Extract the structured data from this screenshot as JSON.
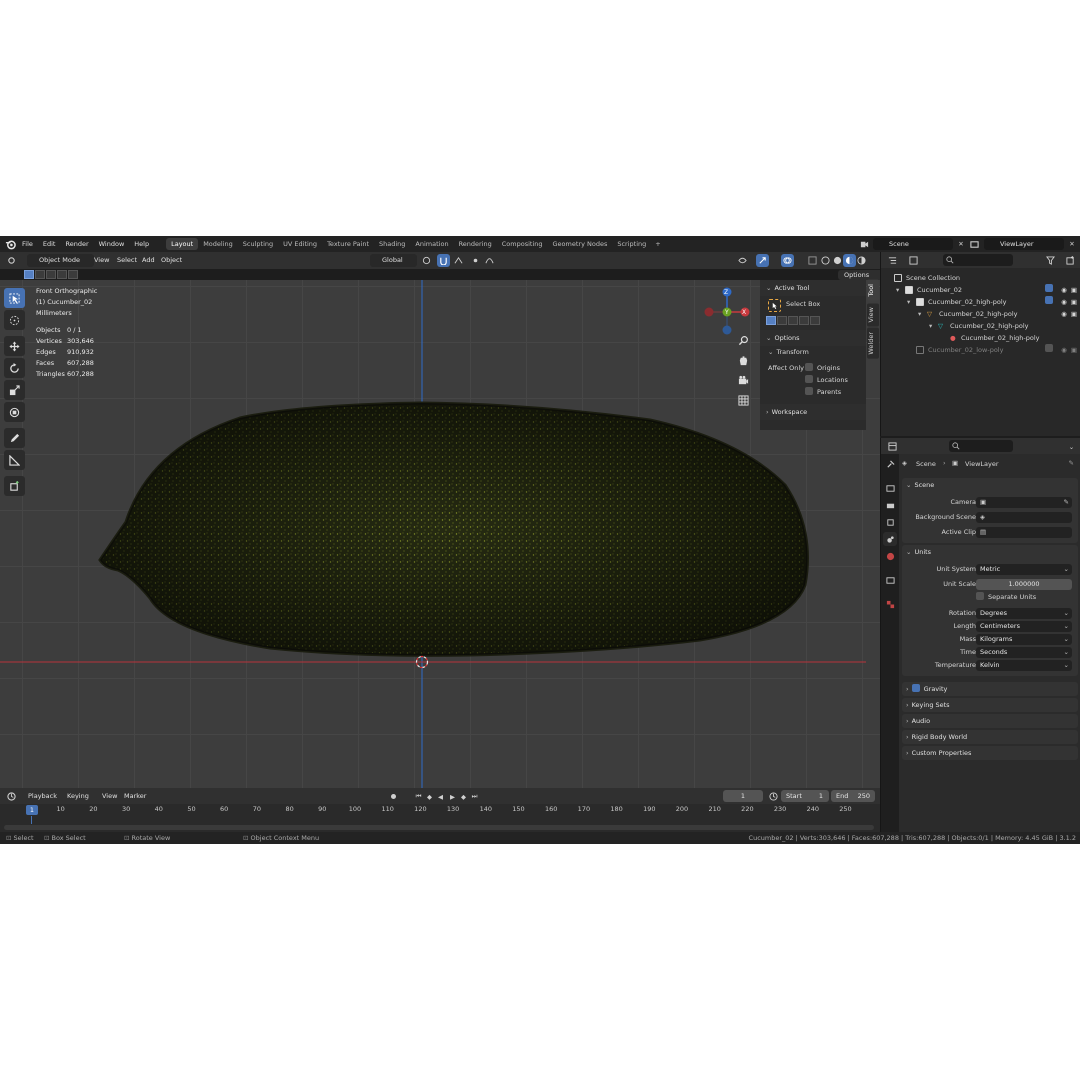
{
  "topbar": {
    "menus": [
      "File",
      "Edit",
      "Render",
      "Window",
      "Help"
    ],
    "workspaces": [
      "Layout",
      "Modeling",
      "Sculpting",
      "UV Editing",
      "Texture Paint",
      "Shading",
      "Animation",
      "Rendering",
      "Compositing",
      "Geometry Nodes",
      "Scripting"
    ],
    "active_workspace": "Layout",
    "plus": "+",
    "scene": "Scene",
    "view_layer": "ViewLayer"
  },
  "viewport_header": {
    "mode": "Object Mode",
    "menus": [
      "View",
      "Select",
      "Add",
      "Object"
    ],
    "orientation": "Global",
    "options": "Options"
  },
  "overlay": {
    "view": "Front Orthographic",
    "object": "(1) Cucumber_02",
    "units": "Millimeters",
    "stats": [
      {
        "label": "Objects",
        "value": "0 / 1"
      },
      {
        "label": "Vertices",
        "value": "303,646"
      },
      {
        "label": "Edges",
        "value": "910,932"
      },
      {
        "label": "Faces",
        "value": "607,288"
      },
      {
        "label": "Triangles",
        "value": "607,288"
      }
    ]
  },
  "gizmo": {
    "z": "Z",
    "y": "Y",
    "x": "X"
  },
  "npanel": {
    "active_tool": "Active Tool",
    "select_box": "Select Box",
    "options": "Options",
    "transform": "Transform",
    "affect_only": "Affect Only",
    "origins": "Origins",
    "locations": "Locations",
    "parents": "Parents",
    "workspace": "Workspace",
    "tabs": [
      "Tool",
      "View",
      "Welder"
    ]
  },
  "timeline": {
    "menus": [
      "Playback",
      "Keying",
      "View",
      "Marker"
    ],
    "current_frame": "1",
    "start_label": "Start",
    "start": "1",
    "end_label": "End",
    "end": "250",
    "ticks": [
      "1",
      "10",
      "20",
      "30",
      "40",
      "50",
      "60",
      "70",
      "80",
      "90",
      "100",
      "110",
      "120",
      "130",
      "140",
      "150",
      "160",
      "170",
      "180",
      "190",
      "200",
      "210",
      "220",
      "230",
      "240",
      "250"
    ]
  },
  "statusbar": {
    "select": "Select",
    "box_select": "Box Select",
    "rotate_view": "Rotate View",
    "context_menu": "Object Context Menu",
    "info": "Cucumber_02 | Verts:303,646 | Faces:607,288 | Tris:607,288 | Objects:0/1 | Memory: 4.45 GiB | 3.1.2"
  },
  "outliner": {
    "rows": [
      {
        "label": "Scene Collection",
        "dim": false
      },
      {
        "label": "Cucumber_02",
        "dim": false
      },
      {
        "label": "Cucumber_02_high-poly",
        "dim": false
      },
      {
        "label": "Cucumber_02_high-poly",
        "dim": false
      },
      {
        "label": "Cucumber_02_high-poly",
        "dim": false
      },
      {
        "label": "Cucumber_02_high-poly",
        "dim": false
      },
      {
        "label": "Cucumber_02_low-poly",
        "dim": true
      }
    ]
  },
  "properties": {
    "breadcrumb_scene": "Scene",
    "breadcrumb_layer": "ViewLayer",
    "scene_section": "Scene",
    "camera_label": "Camera",
    "background_label": "Background Scene",
    "clip_label": "Active Clip",
    "units_section": "Units",
    "unit_system_label": "Unit System",
    "unit_system": "Metric",
    "unit_scale_label": "Unit Scale",
    "unit_scale": "1.000000",
    "separate_units": "Separate Units",
    "rotation_label": "Rotation",
    "rotation": "Degrees",
    "length_label": "Length",
    "length": "Centimeters",
    "mass_label": "Mass",
    "mass": "Kilograms",
    "time_label": "Time",
    "time": "Seconds",
    "temperature_label": "Temperature",
    "temperature": "Kelvin",
    "gravity": "Gravity",
    "keying_sets": "Keying Sets",
    "audio": "Audio",
    "rigid_body": "Rigid Body World",
    "custom_props": "Custom Properties"
  },
  "colors": {
    "accent": "#4772b3",
    "x_axis": "#c8393e",
    "y_axis": "#6aa121",
    "z_axis": "#2e6ac8"
  }
}
